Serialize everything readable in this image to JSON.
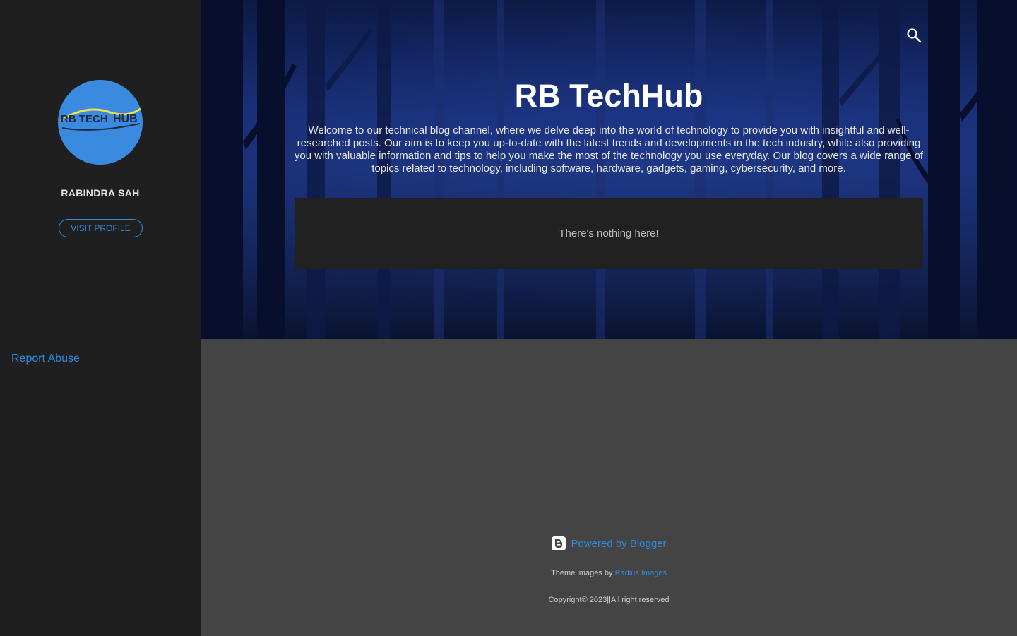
{
  "sidebar": {
    "avatar": {
      "logo_text_left": "RB TECH",
      "logo_text_right": "HUB"
    },
    "profile_name": "RABINDRA SAH",
    "visit_profile_label": "VISIT PROFILE",
    "report_abuse_label": "Report Abuse"
  },
  "header": {
    "search_icon": "search-icon",
    "title": "RB TechHub",
    "description": "Welcome to our technical blog channel, where we delve deep into the world of technology to provide you with insightful and well-researched posts. Our aim is to keep you up-to-date with the latest trends and developments in the tech industry, while also providing you with valuable information and tips to help you make the most of the technology you use everyday. Our blog covers a wide range of topics related to technology, including software, hardware, gadgets, gaming, cybersecurity, and more."
  },
  "main": {
    "empty_message": "There's nothing here!"
  },
  "footer": {
    "powered_by": "Powered by Blogger",
    "theme_prefix": "Theme images by",
    "theme_link": "Radius Images",
    "copyright": "Copyright© 2023||All right reserved"
  },
  "colors": {
    "accent": "#2f8ae0",
    "sidebar_bg": "#1f1f1f",
    "page_bg": "#444444",
    "card_bg": "#212121",
    "avatar_bg": "#3a8be0"
  }
}
